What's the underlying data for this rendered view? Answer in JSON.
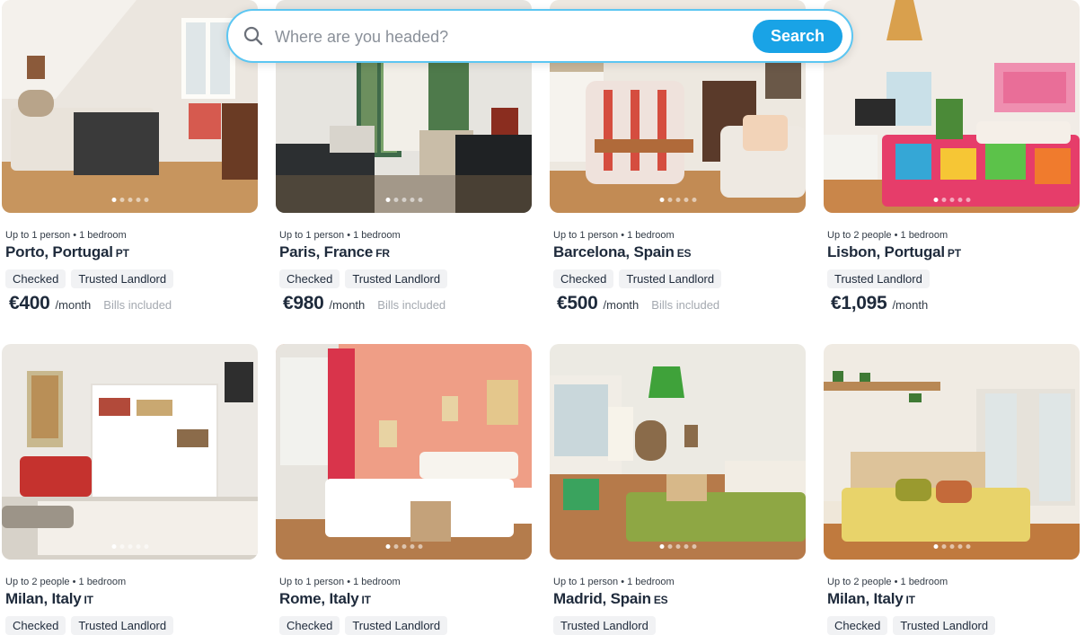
{
  "search": {
    "placeholder": "Where are you headed?",
    "button_label": "Search",
    "accent_color": "#19a3e6",
    "border_color": "#5cc6f2"
  },
  "listings": [
    {
      "meta": "Up to 1 person • 1 bedroom",
      "city": "Porto, Portugal",
      "country_code": "PT",
      "tags": [
        "Checked",
        "Trusted Landlord"
      ],
      "price": "€400",
      "per": "/month",
      "bills": "Bills included",
      "photo": "bedroom-photo",
      "active_photo": 1,
      "photo_count": 5
    },
    {
      "meta": "Up to 1 person • 1 bedroom",
      "city": "Paris, France",
      "country_code": "FR",
      "tags": [
        "Checked",
        "Trusted Landlord"
      ],
      "price": "€980",
      "per": "/month",
      "bills": "Bills included",
      "photo": "studio-photo",
      "active_photo": 1,
      "photo_count": 5
    },
    {
      "meta": "Up to 1 person • 1 bedroom",
      "city": "Barcelona, Spain",
      "country_code": "ES",
      "tags": [
        "Checked",
        "Trusted Landlord"
      ],
      "price": "€500",
      "per": "/month",
      "bills": "Bills included",
      "photo": "living-room-photo",
      "active_photo": 1,
      "photo_count": 5
    },
    {
      "meta": "Up to 2 people • 1 bedroom",
      "city": "Lisbon, Portugal",
      "country_code": "PT",
      "tags": [
        "Trusted Landlord"
      ],
      "price": "€1,095",
      "per": "/month",
      "bills": "",
      "photo": "bedroom-photo",
      "active_photo": 1,
      "photo_count": 5
    },
    {
      "meta": "Up to 2 people • 1 bedroom",
      "city": "Milan, Italy",
      "country_code": "IT",
      "tags": [
        "Checked",
        "Trusted Landlord"
      ],
      "price": "",
      "per": "",
      "bills": "",
      "photo": "bedroom-photo",
      "active_photo": 1,
      "photo_count": 5
    },
    {
      "meta": "Up to 1 person • 1 bedroom",
      "city": "Rome, Italy",
      "country_code": "IT",
      "tags": [
        "Checked",
        "Trusted Landlord"
      ],
      "price": "",
      "per": "",
      "bills": "",
      "photo": "bedroom-photo",
      "active_photo": 1,
      "photo_count": 5
    },
    {
      "meta": "Up to 1 person • 1 bedroom",
      "city": "Madrid, Spain",
      "country_code": "ES",
      "tags": [
        "Trusted Landlord"
      ],
      "price": "",
      "per": "",
      "bills": "",
      "photo": "bedroom-photo",
      "active_photo": 1,
      "photo_count": 5
    },
    {
      "meta": "Up to 2 people • 1 bedroom",
      "city": "Milan, Italy",
      "country_code": "IT",
      "tags": [
        "Checked",
        "Trusted Landlord"
      ],
      "price": "",
      "per": "",
      "bills": "",
      "photo": "bedroom-photo",
      "active_photo": 1,
      "photo_count": 5
    }
  ]
}
